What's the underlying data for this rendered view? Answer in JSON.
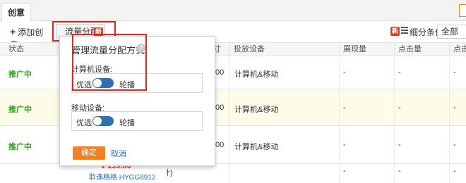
{
  "tabs": {
    "active": "创意"
  },
  "toolbar": {
    "add_label": "添加创意",
    "traffic_label": "流量分配",
    "new_badge": "新",
    "filter_new_badge": "新",
    "filter_label": "细分条件:",
    "filter_value": "全部"
  },
  "table": {
    "headers": [
      "状态",
      "寸",
      "投放设备",
      "展现量",
      "点击量",
      "点击"
    ],
    "rows": [
      {
        "status": "推广中",
        "size": ".00",
        "device": "计算机&移动",
        "impressions": "-",
        "clicks": "-",
        "ctr": "-"
      },
      {
        "status": "推广中",
        "size": ".00",
        "device": "计算机&移动",
        "impressions": "-",
        "clicks": "-",
        "ctr": "-"
      },
      {
        "status": "推广中",
        "size": ".00",
        "device": "计算机&移动",
        "impressions": "-",
        "clicks": "-",
        "ctr": "-"
      }
    ],
    "last_row": {
      "size": "计)",
      "device": "",
      "impressions": "-",
      "clicks": "-",
      "ctr": "-"
    }
  },
  "popup": {
    "title": "管理流量分配方式",
    "help": "?",
    "computer_label": "计算机设备:",
    "mobile_label": "移动设备:",
    "computer_left": "优选",
    "computer_right": "轮播",
    "mobile_left": "优选",
    "mobile_right": "轮播",
    "ok": "确定",
    "cancel": "取消",
    "computer_toggle_on": true,
    "mobile_toggle_on": true
  },
  "product": {
    "price": "¥ 195.00",
    "name": "聆逸格格 HYGG8912"
  },
  "colors": {
    "accent": "#f08223",
    "status_green": "#2aa515",
    "toggle_blue": "#2f6fb5",
    "highlight_red": "#e2241e",
    "link_blue": "#2a6cb7"
  }
}
